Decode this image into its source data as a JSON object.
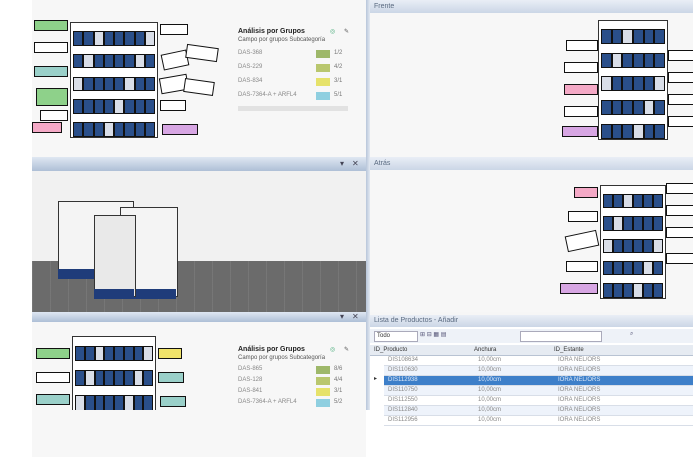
{
  "top_right_pane": {
    "title": "Frente"
  },
  "mid_right_pane": {
    "title": "Atrás"
  },
  "list_pane": {
    "title": "Lista de Productos - Añadir"
  },
  "analysis_top": {
    "title": "Análisis por Grupos",
    "subtitle": "Campo por grupos  Subcategoría",
    "rows": [
      {
        "label": "DAS-368",
        "value": "1/2",
        "color": "#9eb86a"
      },
      {
        "label": "DAS-229",
        "value": "4/2",
        "color": "#b9c76e"
      },
      {
        "label": "DAS-834",
        "value": "3/1",
        "color": "#e6e26a"
      },
      {
        "label": "DAS-7364-A + ARFL4",
        "value": "5/1",
        "color": "#8fcfe0"
      }
    ]
  },
  "analysis_bottom": {
    "title": "Análisis por Grupos",
    "subtitle": "Campo por grupos  Subcategoría",
    "rows": [
      {
        "label": "DAS-865",
        "value": "8/6",
        "color": "#9eb86a"
      },
      {
        "label": "DAS-128",
        "value": "4/4",
        "color": "#b9c76e"
      },
      {
        "label": "DAS-841",
        "value": "3/1",
        "color": "#e6e26a"
      },
      {
        "label": "DAS-7364-A + ARFL4",
        "value": "5/2",
        "color": "#8fcfe0"
      }
    ]
  },
  "grid": {
    "toolbar_filter": "Todo",
    "columns": [
      "ID_Producto",
      "Anchura",
      "ID_Estante"
    ],
    "rows": [
      {
        "id": "DIS108634",
        "width": "10,00cm",
        "shelf": "IORA NEL/ORS"
      },
      {
        "id": "DIS110630",
        "width": "10,00cm",
        "shelf": "IORA NEL/ORS"
      },
      {
        "id": "DIS112938",
        "width": "10,00cm",
        "shelf": "IORA NEL/ORS"
      },
      {
        "id": "DIS110750",
        "width": "10,00cm",
        "shelf": "IORA NEL/ORS"
      },
      {
        "id": "DIS112550",
        "width": "10,00cm",
        "shelf": "IORA NEL/ORS"
      },
      {
        "id": "DIS112840",
        "width": "10,00cm",
        "shelf": "IORA NEL/ORS"
      },
      {
        "id": "DIS112956",
        "width": "10,00cm",
        "shelf": "IORA NEL/ORS"
      }
    ],
    "selected_index": 2
  },
  "colors": {
    "accent": "#3d7fc9",
    "pane_bar": "#aebfd6",
    "product": "#2a4f8a"
  }
}
